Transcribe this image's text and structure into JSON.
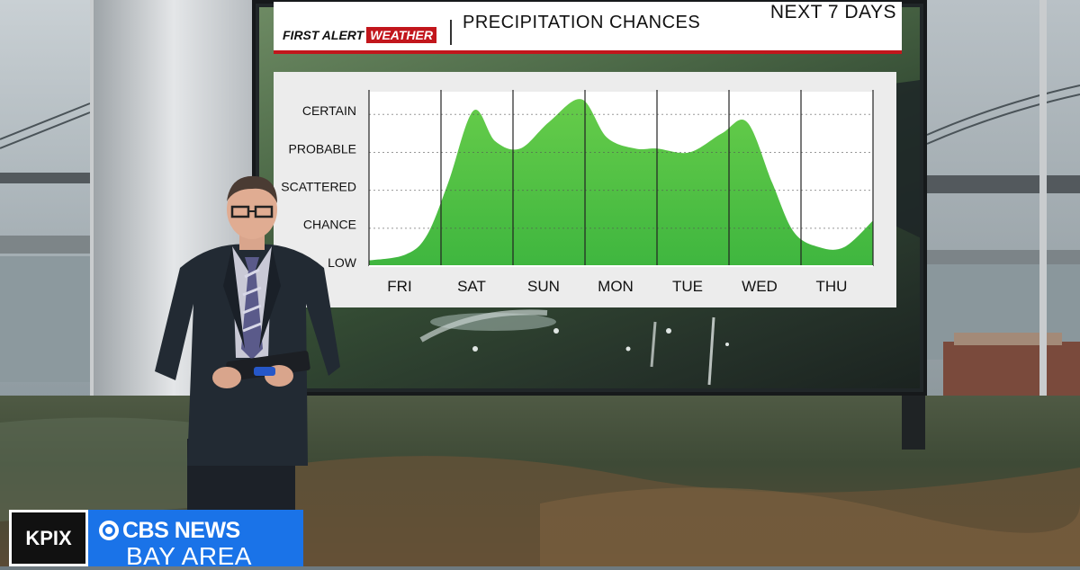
{
  "graphic": {
    "brand_first": "FIRST ALERT",
    "brand_second": "WEATHER",
    "title": "PRECIPITATION CHANCES",
    "period": "NEXT 7 DAYS"
  },
  "chart_data": {
    "type": "area",
    "title": "PRECIPITATION CHANCES",
    "x_categories": [
      "FRI",
      "SAT",
      "SUN",
      "MON",
      "TUE",
      "WED",
      "THU"
    ],
    "y_levels": [
      "LOW",
      "CHANCE",
      "SCATTERED",
      "PROBABLE",
      "CERTAIN"
    ],
    "series": [
      {
        "values_by_position": [
          [
            0.0,
            0.15
          ],
          [
            0.5,
            0.3
          ],
          [
            0.8,
            0.8
          ],
          [
            1.1,
            2.2
          ],
          [
            1.45,
            4.1
          ],
          [
            1.75,
            3.3
          ],
          [
            2.1,
            3.1
          ],
          [
            2.5,
            3.8
          ],
          [
            2.95,
            4.4
          ],
          [
            3.3,
            3.4
          ],
          [
            3.7,
            3.1
          ],
          [
            4.0,
            3.1
          ],
          [
            4.45,
            3.0
          ],
          [
            4.9,
            3.5
          ],
          [
            5.25,
            3.8
          ],
          [
            5.6,
            2.2
          ],
          [
            5.9,
            0.9
          ],
          [
            6.25,
            0.5
          ],
          [
            6.6,
            0.5
          ],
          [
            7.0,
            1.2
          ]
        ]
      }
    ],
    "colors": {
      "fill": "#3fb63f",
      "fill_light": "#66cc4a",
      "grid": "#222222"
    },
    "ylim": [
      0,
      4.6
    ]
  },
  "lower_third": {
    "station": "KPIX",
    "network": "CBS NEWS",
    "region": "BAY AREA",
    "accent": "#1a73e8"
  }
}
